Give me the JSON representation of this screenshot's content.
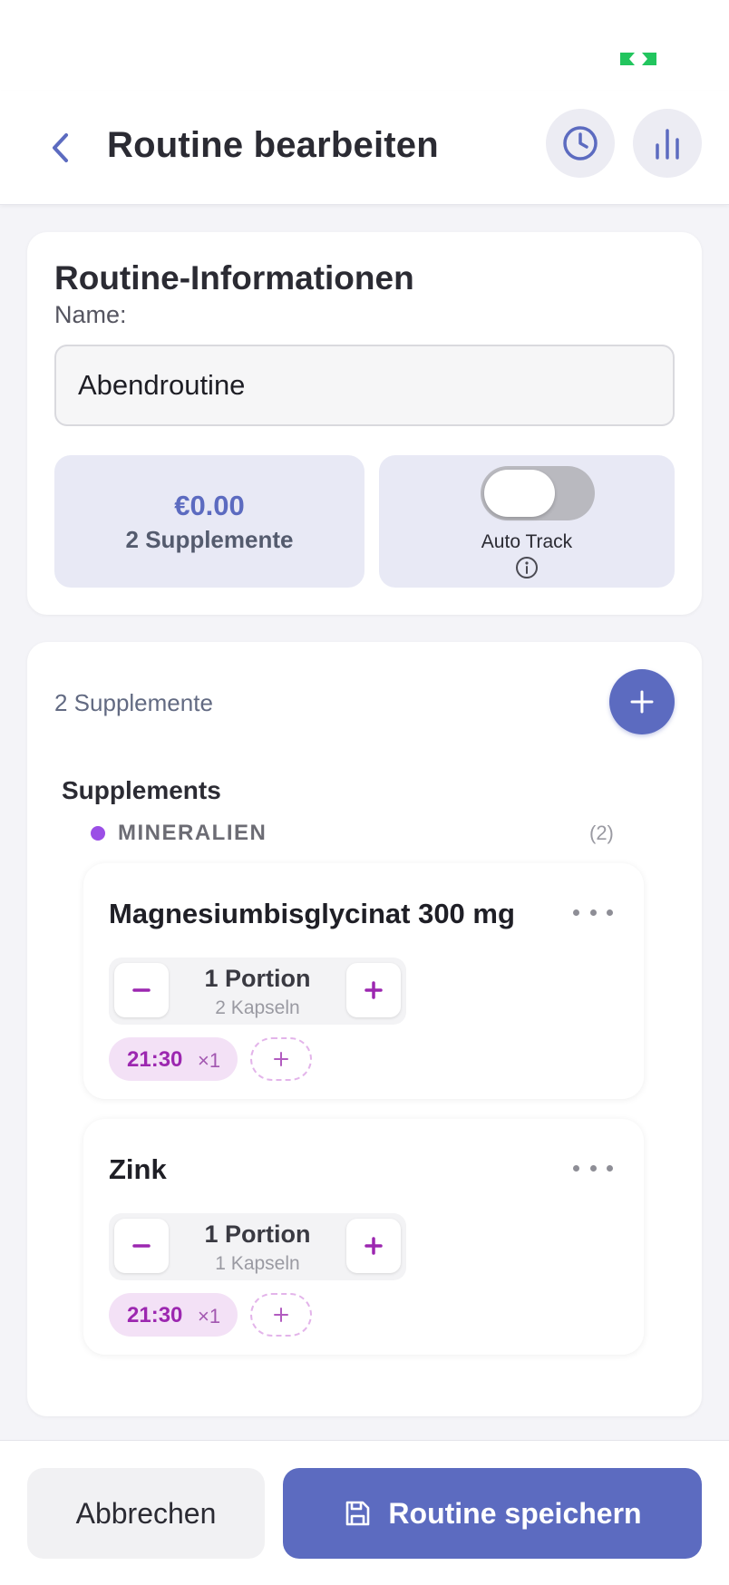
{
  "header": {
    "title": "Routine bearbeiten",
    "back_icon": "chevron-left-icon",
    "history_icon": "clock-icon",
    "stats_icon": "bar-chart-icon"
  },
  "routine_info": {
    "title": "Routine-Informationen",
    "name_label": "Name:",
    "name_value": "Abendroutine",
    "cost": "€0.00",
    "supplement_count_label": "2 Supplemente",
    "auto_track_label": "Auto Track",
    "auto_track_enabled": false
  },
  "supplements": {
    "count_label": "2 Supplemente",
    "section_title": "Supplements",
    "category": {
      "name": "MINERALIEN",
      "count": "(2)",
      "color": "#9b4fe6"
    },
    "items": [
      {
        "name": "Magnesiumbisglycinat 300 mg",
        "portion": "1 Portion",
        "capsules": "2 Kapseln",
        "time": "21:30",
        "multiplier": "×1"
      },
      {
        "name": "Zink",
        "portion": "1 Portion",
        "capsules": "1 Kapseln",
        "time": "21:30",
        "multiplier": "×1"
      }
    ]
  },
  "footer": {
    "cancel_label": "Abbrechen",
    "save_label": "Routine speichern",
    "save_icon": "floppy-disk-icon"
  },
  "colors": {
    "accent": "#5c6bc0",
    "time_chip": "#9c27b0",
    "battery": "#22c55e"
  }
}
